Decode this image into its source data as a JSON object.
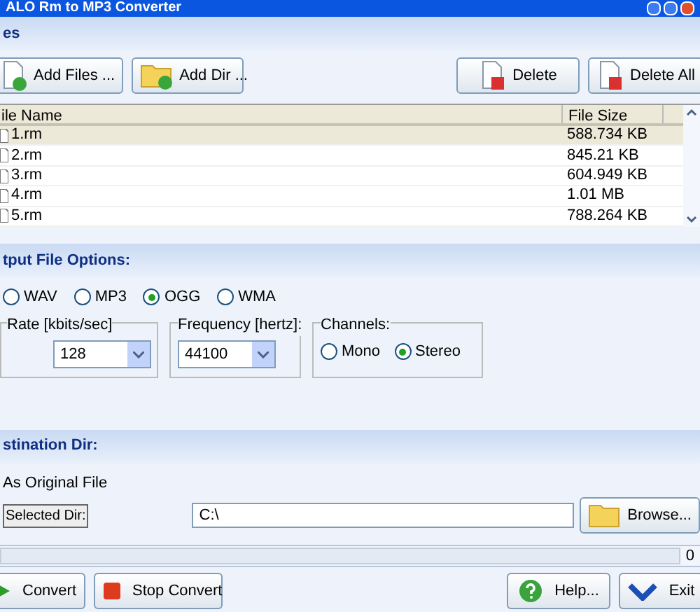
{
  "window": {
    "title": "ALO Rm to MP3 Converter"
  },
  "files_section": {
    "title": "es",
    "buttons": [
      "Add Files ...",
      "Add Dir ...",
      "Delete",
      "Delete All"
    ]
  },
  "table": {
    "columns": [
      "ile Name",
      "File Size"
    ],
    "rows": [
      {
        "name": "1.rm",
        "size": "588.734 KB",
        "selected": true
      },
      {
        "name": "2.rm",
        "size": "845.21 KB",
        "selected": false
      },
      {
        "name": "3.rm",
        "size": "604.949 KB",
        "selected": false
      },
      {
        "name": "4.rm",
        "size": "1.01 MB",
        "selected": false
      },
      {
        "name": "5.rm",
        "size": "788.264 KB",
        "selected": false
      }
    ]
  },
  "output_options": {
    "title": "tput File Options:",
    "formats": [
      {
        "label": "WAV",
        "selected": false
      },
      {
        "label": "MP3",
        "selected": false
      },
      {
        "label": "OGG",
        "selected": true
      },
      {
        "label": "WMA",
        "selected": false
      }
    ],
    "rate": {
      "label": "Rate [kbits/sec]",
      "value": "128"
    },
    "frequency": {
      "label": "Frequency [hertz]:",
      "value": "44100"
    },
    "channels": {
      "label": "Channels:",
      "options": [
        {
          "label": "Mono",
          "selected": false
        },
        {
          "label": "Stereo",
          "selected": true
        }
      ]
    }
  },
  "destination": {
    "title": "stination Dir:",
    "same_label": "As Original File",
    "selected_dir_label": "Selected Dir:",
    "path": "C:\\",
    "browse": "Browse..."
  },
  "progress": {
    "level": 0,
    "reading": "0"
  },
  "bottom_buttons": [
    {
      "kind": "convert",
      "label": "Convert"
    },
    {
      "kind": "stop",
      "label": "Stop Convert"
    },
    {
      "kind": "help",
      "label": "Help..."
    },
    {
      "kind": "exit",
      "label": "Exit"
    }
  ]
}
